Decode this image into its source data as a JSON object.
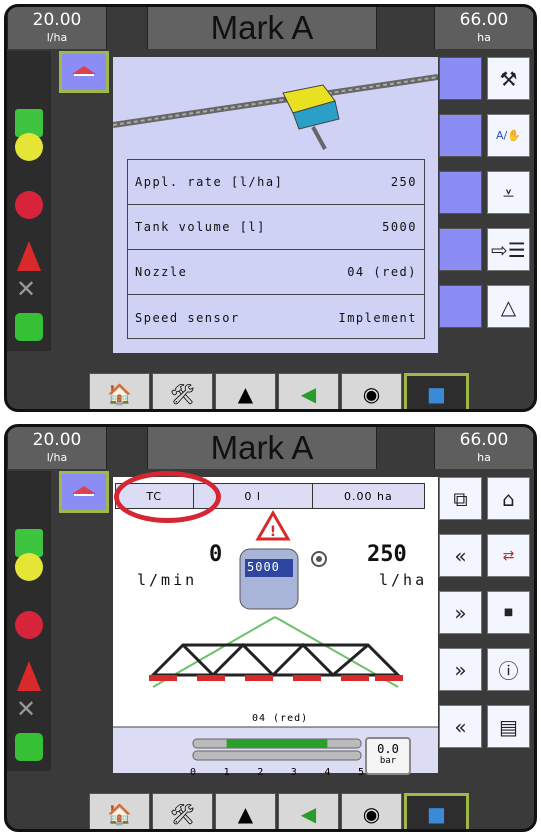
{
  "screen_top": {
    "left_header": {
      "value": "20.00",
      "unit": "l/ha"
    },
    "title": "Mark A",
    "right_header": {
      "value": "66.00",
      "unit": "ha"
    },
    "settings": [
      {
        "label": "Appl. rate [l/ha]",
        "value": "250"
      },
      {
        "label": "Tank volume [l]",
        "value": "5000"
      },
      {
        "label": "Nozzle",
        "value": "04 (red)"
      },
      {
        "label": "Speed sensor",
        "value": "Implement"
      }
    ]
  },
  "screen_bottom": {
    "left_header": {
      "value": "20.00",
      "unit": "l/ha"
    },
    "title": "Mark A",
    "right_header": {
      "value": "66.00",
      "unit": "ha"
    },
    "status": {
      "mode": "TC",
      "volume": "0 l",
      "area": "0.00 ha"
    },
    "flow": {
      "value": "0",
      "unit": "l/min"
    },
    "rate": {
      "value": "250",
      "unit": "l/ha"
    },
    "tank_label": "5000",
    "nozzle": "04 (red)",
    "pressure": {
      "value": "0.0",
      "unit": "bar"
    },
    "pressure_ticks": [
      "0",
      "1",
      "2",
      "3",
      "4",
      "5"
    ],
    "pressure_fill_range": [
      1,
      4
    ]
  },
  "colors": {
    "accent": "#8c8cf5",
    "highlight": "#a0b84a",
    "callout": "#d62633"
  },
  "icons": {
    "left_col": [
      "boom-section-icon",
      "red-lamp-icon",
      "boom-cone-icon",
      "sensor-icon"
    ],
    "right_top": [
      "worker-icon",
      "auto-manual-icon",
      "boom-height-icon",
      "menu-list-icon",
      "rotate-icon"
    ],
    "right_bottom_col1": [
      "copy-icon",
      "rate-decrease-icon",
      "rate-increase-icon",
      "rate-increase-alt-icon",
      "rate-decrease-alt-icon"
    ],
    "right_bottom_col2": [
      "home-icon",
      "rate-toggle-icon",
      "stop-icon",
      "info-icon",
      "tank-icon"
    ],
    "bottom_bar": [
      "home-icon",
      "tools-icon",
      "field-icon",
      "flag-icon",
      "camera-icon",
      "screens-icon"
    ]
  }
}
